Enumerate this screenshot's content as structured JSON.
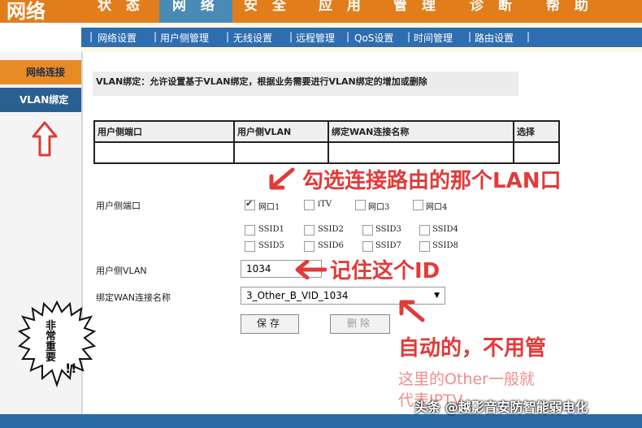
{
  "logo": "网络",
  "nav": [
    "状 态",
    "网 络",
    "安 全",
    "应 用",
    "管 理",
    "诊 断",
    "帮 助"
  ],
  "subnav": [
    "网络设置",
    "用户侧管理",
    "无线设置",
    "远程管理",
    "QoS设置",
    "时间管理",
    "路由设置"
  ],
  "sidebar": [
    "网络连接",
    "VLAN绑定"
  ],
  "description": "VLAN绑定：允许设置基于VLAN绑定，根据业务需要进行VLAN绑定的增加或删除",
  "table": {
    "headers": [
      "用户侧端口",
      "用户侧VLAN",
      "绑定WAN连接名称",
      "选择"
    ]
  },
  "form": {
    "port_label": "用户侧端口",
    "ports": [
      {
        "label": "网口1",
        "checked": true
      },
      {
        "label": "iTV",
        "checked": false
      },
      {
        "label": "网口3",
        "checked": false
      },
      {
        "label": "网口4",
        "checked": false
      },
      {
        "label": "SSID1",
        "checked": false
      },
      {
        "label": "SSID2",
        "checked": false
      },
      {
        "label": "SSID3",
        "checked": false
      },
      {
        "label": "SSID4",
        "checked": false
      },
      {
        "label": "SSID5",
        "checked": false
      },
      {
        "label": "SSID6",
        "checked": false
      },
      {
        "label": "SSID7",
        "checked": false
      },
      {
        "label": "SSID8",
        "checked": false
      }
    ],
    "vlan_label": "用户侧VLAN",
    "vlan_value": "1034",
    "wan_label": "绑定WAN连接名称",
    "wan_value": "3_Other_B_VID_1034",
    "save": "保存",
    "delete": "删除"
  },
  "annotations": {
    "tick_lan": "勾选连接路由的那个LAN口",
    "remember_id": "记住这个ID",
    "auto": "自动的，不用管",
    "other_note_1": "这里的Other一般就",
    "other_note_2": "代表IPTV",
    "important": "非常重要",
    "watermark": "头条 @越影音安防智能弱电化"
  },
  "colors": {
    "accent": "#e27d1c",
    "nav_blue": "#2e6eb0",
    "annotation": "#e23a3a"
  }
}
